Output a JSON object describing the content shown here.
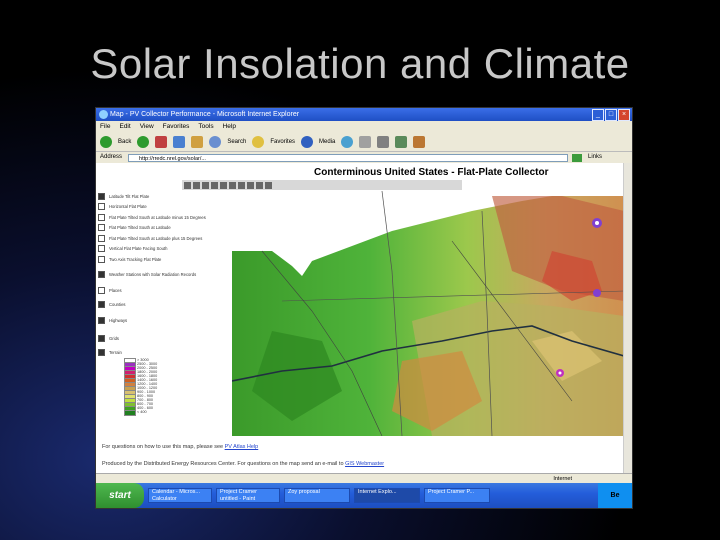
{
  "slide": {
    "title": "Solar Insolation and Climate"
  },
  "browser": {
    "window_title": "Map - PV Collector Performance - Microsoft Internet Explorer",
    "menu": [
      "File",
      "Edit",
      "View",
      "Favorites",
      "Tools",
      "Help"
    ],
    "toolbar": {
      "back_label": "Back",
      "search_label": "Search",
      "favorites_label": "Favorites",
      "media_label": "Media"
    },
    "address": {
      "label": "Address",
      "value": "http://rredc.nrel.gov/solar/...",
      "links_label": "Links"
    },
    "status": {
      "zone": "Internet"
    }
  },
  "page": {
    "heading": "Conterminous United States - Flat-Plate Collector",
    "legend": [
      "Latitude Tilt Flat Plate",
      "Horizontal Flat Plate",
      "Flat Plate Tilted South at Latitude minus 15 Degrees",
      "Flat Plate Tilted South at Latitude",
      "Flat Plate Tilted South at Latitude plus 15 Degrees",
      "Vertical Flat Plate Facing South",
      "Two Axis Tracking Flat Plate",
      "Weather Stations with Solar Radiation Records",
      "Places",
      "Counties",
      "Highways",
      "Grids",
      "Terrain"
    ],
    "scale": [
      {
        "label": "> 3000",
        "color": "#ffffff"
      },
      {
        "label": "2500 - 3000",
        "color": "#9b30c0"
      },
      {
        "label": "2000 - 2500",
        "color": "#c000c0"
      },
      {
        "label": "1800 - 2000",
        "color": "#d02070"
      },
      {
        "label": "1600 - 1800",
        "color": "#d03030"
      },
      {
        "label": "1400 - 1600",
        "color": "#d06020"
      },
      {
        "label": "1200 - 1400",
        "color": "#d08040"
      },
      {
        "label": "1000 - 1200",
        "color": "#c8a050"
      },
      {
        "label": "900 - 1000",
        "color": "#d8c070"
      },
      {
        "label": "800 - 900",
        "color": "#e0e070"
      },
      {
        "label": "700 - 800",
        "color": "#c0e040"
      },
      {
        "label": "600 - 700",
        "color": "#80c030"
      },
      {
        "label": "400 - 600",
        "color": "#40a020"
      },
      {
        "label": "< 400",
        "color": "#208020"
      }
    ],
    "footer_prefix": "For questions on how to use this map, please see",
    "footer_link": "PV Atlas Help",
    "footer2_prefix": "Produced by the Distributed Energy Resources Center. For questions on the map send an e-mail to",
    "footer2_link": "GIS Webmaster"
  },
  "taskbar": {
    "start_label": "start",
    "items": [
      "Calendar - Micros...",
      "Project Cramer",
      "Zoy proposal",
      "Internet Explo...",
      "Project Cramer P..."
    ],
    "second_row": [
      "Calculator",
      "untitled - Paint"
    ],
    "tray_label": "Be"
  }
}
